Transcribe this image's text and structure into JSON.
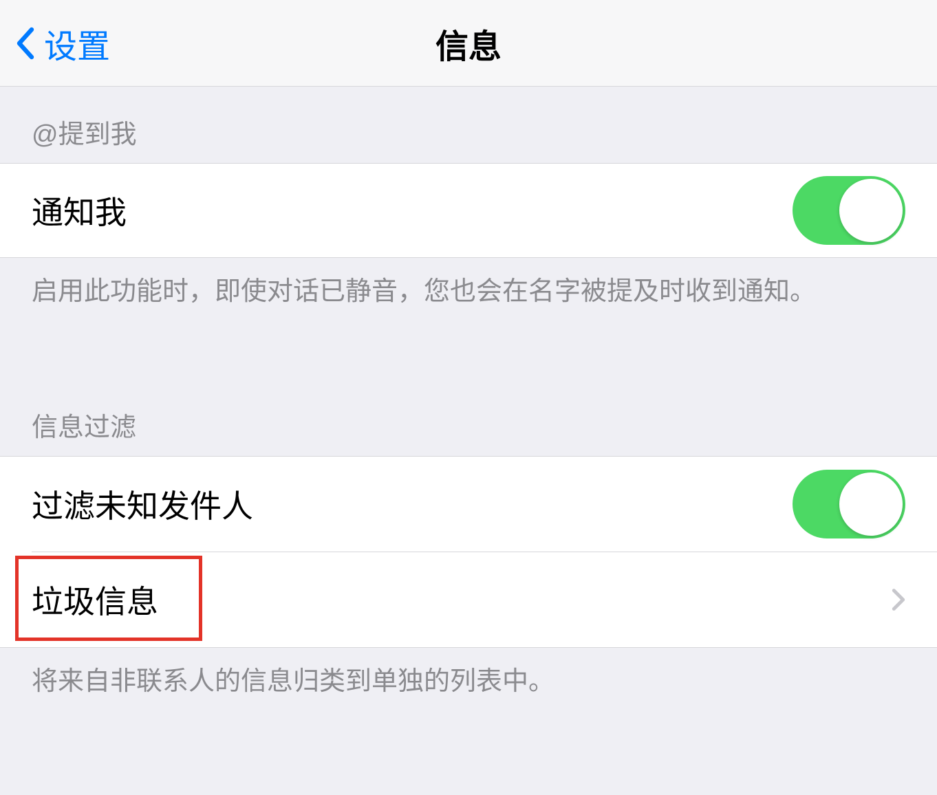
{
  "nav": {
    "back_label": "设置",
    "title": "信息"
  },
  "sections": {
    "mentions": {
      "header": "@提到我",
      "notify_me_label": "通知我",
      "notify_me_on": true,
      "footer": "启用此功能时，即使对话已静音，您也会在名字被提及时收到通知。"
    },
    "filtering": {
      "header": "信息过滤",
      "filter_unknown_label": "过滤未知发件人",
      "filter_unknown_on": true,
      "junk_label": "垃圾信息",
      "footer": "将来自非联系人的信息归类到单独的列表中。"
    }
  }
}
